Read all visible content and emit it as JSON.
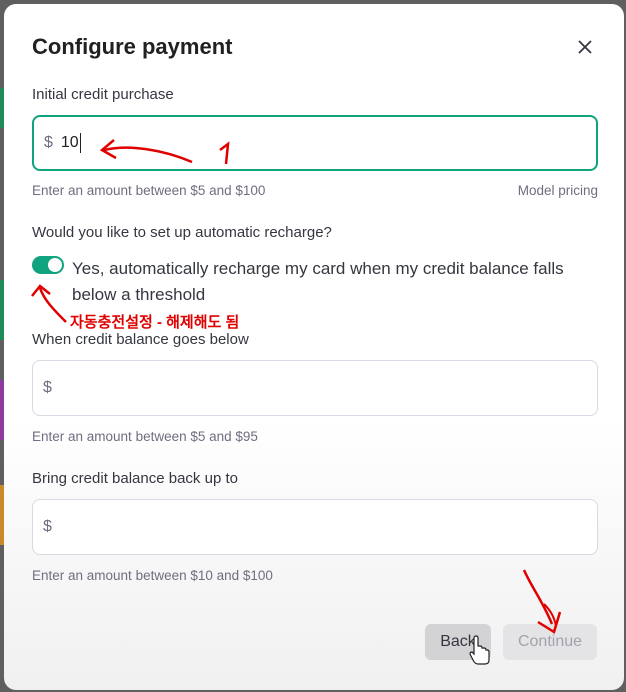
{
  "dialog": {
    "title": "Configure payment",
    "close_icon": "close-icon"
  },
  "initial_purchase": {
    "label": "Initial credit purchase",
    "currency": "$",
    "value": "10",
    "hint": "Enter an amount between $5 and $100",
    "pricing_link": "Model pricing"
  },
  "auto_recharge": {
    "question": "Would you like to set up automatic recharge?",
    "toggle_on": true,
    "toggle_label": "Yes, automatically recharge my card when my credit balance falls below a threshold"
  },
  "threshold": {
    "label": "When credit balance goes below",
    "currency": "$",
    "value": "",
    "hint": "Enter an amount between $5 and $95"
  },
  "recharge_to": {
    "label": "Bring credit balance back up to",
    "currency": "$",
    "value": "",
    "hint": "Enter an amount between $10 and $100"
  },
  "buttons": {
    "back": "Back",
    "continue": "Continue"
  },
  "annotations": {
    "number": "1",
    "note": "자동충전설정 - 해제해도 됨",
    "color": "#e00000"
  },
  "colors": {
    "accent": "#10a37f",
    "annotation": "#e00000"
  }
}
